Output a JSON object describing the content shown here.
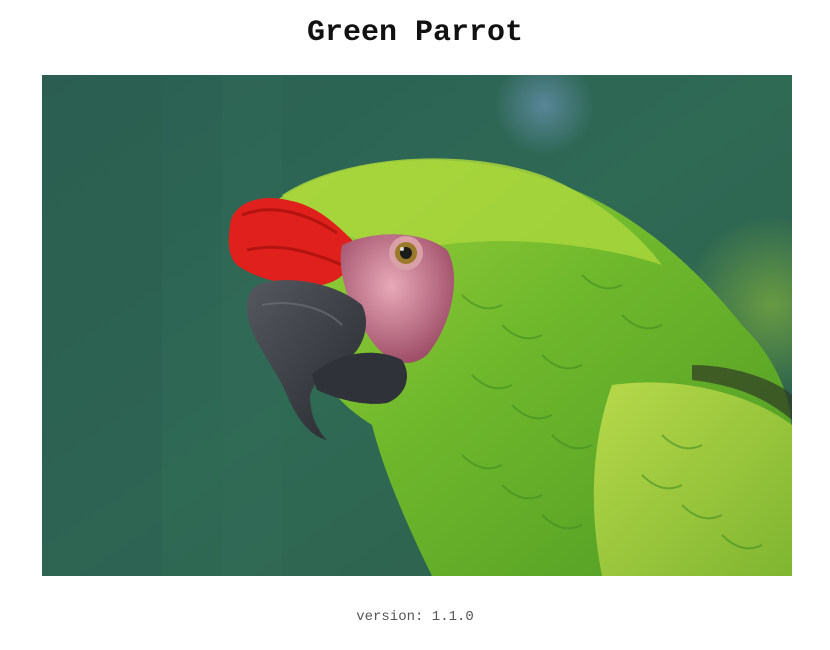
{
  "page": {
    "title": "Green Parrot",
    "version_label": "version: 1.1.0"
  },
  "image": {
    "subject": "parrot-photo",
    "colors": {
      "background": "#2f6552",
      "feathers_light": "#a7d43a",
      "feathers_mid": "#6fb52a",
      "feathers_dark": "#3f8a22",
      "forehead_red": "#e0201c",
      "face_pink": "#d48a9a",
      "beak": "#3b3f47"
    }
  }
}
